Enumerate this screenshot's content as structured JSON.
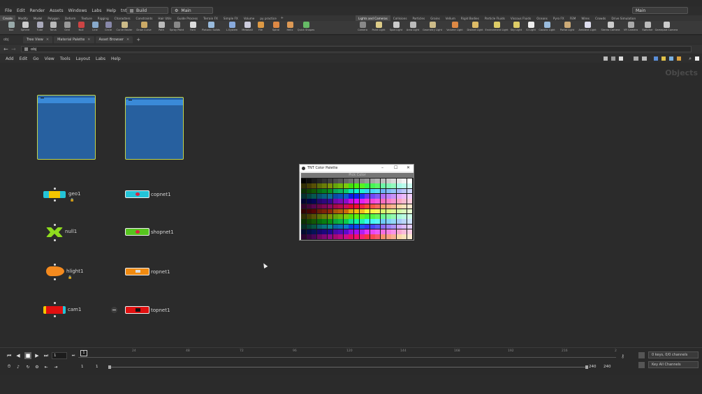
{
  "menubar": {
    "items": [
      "File",
      "Edit",
      "Render",
      "Assets",
      "Windows",
      "Labs",
      "Help",
      "tnt script"
    ],
    "desktop_dropdown": "Build",
    "network_dropdown": "Main",
    "right_dropdown": "Main"
  },
  "shelf_tabs_left": [
    "Create",
    "Modify",
    "Model",
    "Polygon",
    "Deform",
    "Texture",
    "Rigging",
    "Characters",
    "Constraints",
    "Hair Utils",
    "Guide Process",
    "Terrain FX",
    "Simple FX",
    "Volume",
    "py practice"
  ],
  "shelf_tabs_right": [
    "Lights and Cameras",
    "Collisions",
    "Particles",
    "Grains",
    "Vellum",
    "Rigid Bodies",
    "Particle Fluids",
    "Viscous Fluids",
    "Oceans",
    "Pyro FX",
    "FEM",
    "Wires",
    "Crowds",
    "Drive Simulation"
  ],
  "shelf_tools_left": [
    "Box",
    "Sphere",
    "Tube",
    "Torus",
    "Grid",
    "Null",
    "Line",
    "Circle",
    "Curve Bezier",
    "Draw Curve",
    "Path",
    "Spray Paint",
    "Font",
    "Platonic Solids",
    "L-System",
    "Metaball",
    "File",
    "Spiral",
    "Helix",
    "Quick Shapes"
  ],
  "shelf_tools_right": [
    "Camera",
    "Point Light",
    "Spot Light",
    "Area Light",
    "Geometry Light",
    "Volume Light",
    "Distant Light",
    "Environment Light",
    "Sky Light",
    "GI Light",
    "Caustic Light",
    "Portal Light",
    "Ambient Light",
    "Stereo Camera",
    "VR Camera",
    "Switcher",
    "Gamepad Camera"
  ],
  "pane_tabs": [
    "Tree View",
    "Material Palette",
    "Asset Browser"
  ],
  "path": {
    "context": "obj",
    "value": "obj"
  },
  "net_menu": [
    "Add",
    "Edit",
    "Go",
    "View",
    "Tools",
    "Layout",
    "Labs",
    "Help"
  ],
  "canvas": {
    "context_label": "Objects"
  },
  "nodes": [
    {
      "name": "geo1",
      "type": "geo",
      "color": "#f4c400"
    },
    {
      "name": "null1",
      "type": "null",
      "color": "#8fdc1e"
    },
    {
      "name": "hlight1",
      "type": "light",
      "color": "#f48a1e"
    },
    {
      "name": "cam1",
      "type": "cam",
      "color": "#e01010"
    },
    {
      "name": "copnet1",
      "type": "cop",
      "color": "#23c4d8"
    },
    {
      "name": "shopnet1",
      "type": "shop",
      "color": "#56c41e"
    },
    {
      "name": "ropnet1",
      "type": "rop",
      "color": "#f08a10"
    },
    {
      "name": "topnet1",
      "type": "top",
      "color": "#e01010"
    }
  ],
  "palette_window": {
    "title": "TNT Color Palette",
    "header": "Pick Color",
    "minimize": "–",
    "maximize": "☐",
    "close": "✕"
  },
  "timeline": {
    "current_frame": "1",
    "ticks": [
      "24",
      "48",
      "72",
      "96",
      "120",
      "144",
      "168",
      "192",
      "216",
      "2"
    ],
    "marker": "1",
    "range_start": "1",
    "range_start2": "1",
    "range_end": "240",
    "range_end2": "240",
    "keys_info": "0 keys, 0/0 channels",
    "key_channels": "Key All Channels"
  }
}
